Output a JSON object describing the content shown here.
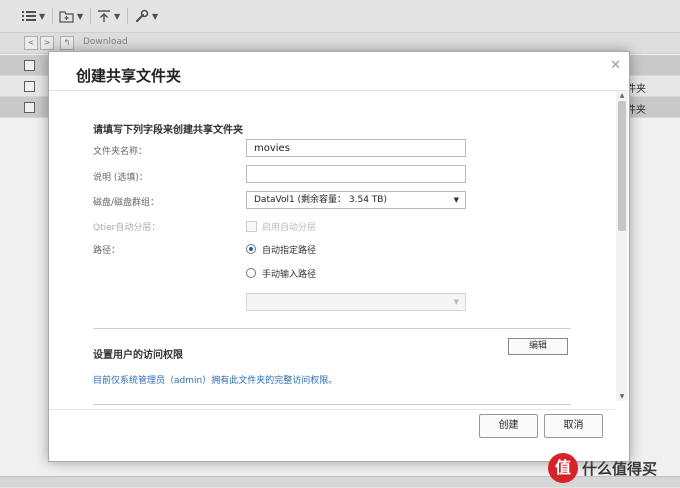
{
  "background": {
    "path_label": "Download",
    "row_texts": [
      "",
      "件夹",
      "件夹"
    ]
  },
  "dialog": {
    "title": "创建共享文件夹",
    "section_fields_title": "请填写下列字段来创建共享文件夹",
    "fields": {
      "folder_name": {
        "label": "文件夹名称：",
        "value": "movies"
      },
      "description": {
        "label": "说明 (选填)：",
        "value": ""
      },
      "volume": {
        "label": "磁盘/磁盘群组：",
        "value": "DataVol1 (剩余容量： 3.54 TB)"
      },
      "qtier": {
        "label": "Qtier自动分层：",
        "checkbox_label": "启用自动分层",
        "checked": false
      },
      "path": {
        "label": "路径：",
        "options": [
          "自动指定路径",
          "手动输入路径"
        ],
        "selected_index": 0,
        "manual_path_value": ""
      }
    },
    "permissions": {
      "title": "设置用户的访问权限",
      "edit_label": "编辑",
      "note": "目前仅系统管理员（admin）拥有此文件夹的完整访问权限。"
    },
    "buttons": {
      "create": "创建",
      "cancel": "取消"
    }
  },
  "watermark": {
    "badge": "值",
    "text": "什么值得买"
  },
  "colors": {
    "link": "#2a6db5",
    "radio_selected": "#1e5fa8"
  }
}
